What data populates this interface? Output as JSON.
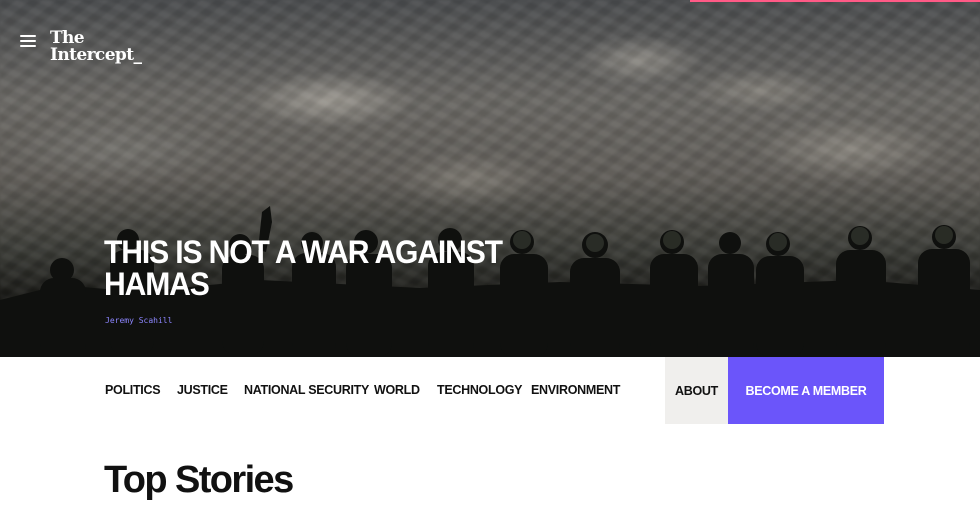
{
  "brand": {
    "logo_line1": "The",
    "logo_line2": "Intercept_",
    "accent_color": "#6b55fa",
    "top_accent_color": "#ff5a86"
  },
  "header": {
    "menu_icon": "hamburger-menu-icon"
  },
  "hero": {
    "headline": "THIS IS NOT A WAR AGAINST HAMAS",
    "author": "Jeremy Scahill"
  },
  "nav": {
    "items": [
      "POLITICS",
      "JUSTICE",
      "NATIONAL SECURITY",
      "WORLD",
      "TECHNOLOGY",
      "ENVIRONMENT"
    ],
    "about": "ABOUT",
    "member": "BECOME A MEMBER"
  },
  "main": {
    "section_title": "Top Stories"
  }
}
